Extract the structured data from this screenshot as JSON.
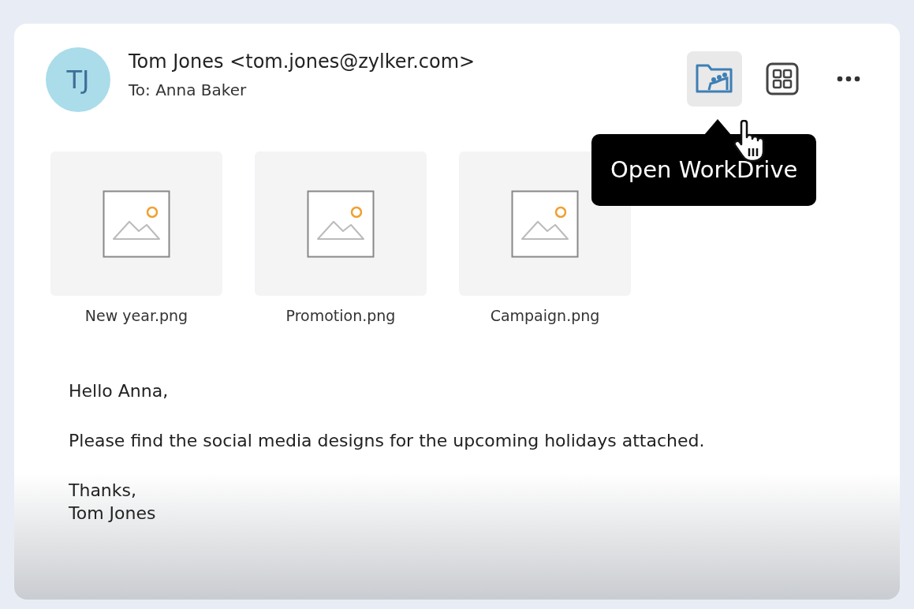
{
  "sender": {
    "initials": "TJ",
    "from": "Tom Jones <tom.jones@zylker.com>",
    "to": "To: Anna Baker"
  },
  "toolbar": [
    {
      "kind": "workdrive",
      "hovered": true
    },
    {
      "kind": "apps",
      "hovered": false
    },
    {
      "kind": "more",
      "hovered": false
    }
  ],
  "tooltip": {
    "text": "Open WorkDrive"
  },
  "attachments": [
    {
      "name": "New year.png"
    },
    {
      "name": "Promotion.png"
    },
    {
      "name": "Campaign.png"
    }
  ],
  "body": {
    "greeting": "Hello Anna,",
    "message": "Please find the social media designs for the upcoming holidays attached.",
    "closing": "Thanks,",
    "signature": "Tom Jones"
  }
}
